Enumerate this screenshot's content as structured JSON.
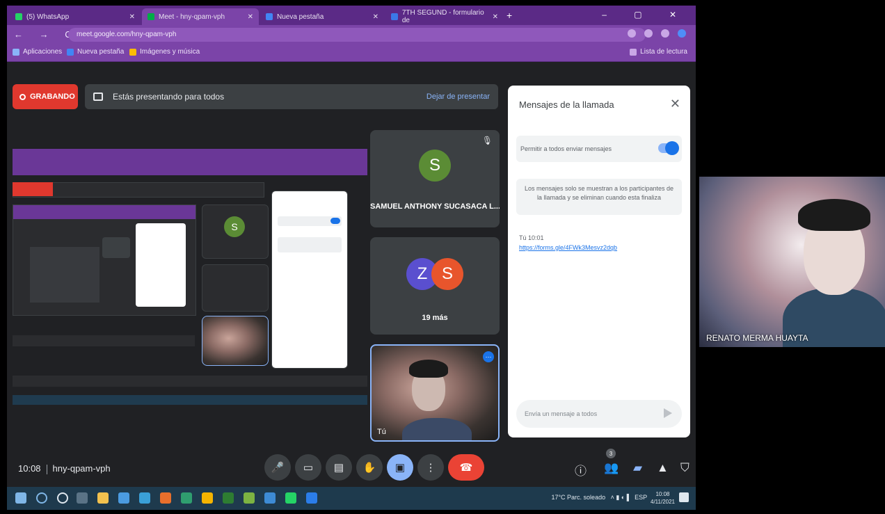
{
  "browser": {
    "tabs": [
      {
        "title": "(5) WhatsApp",
        "color": "#25d366",
        "active": false
      },
      {
        "title": "Meet - hny-qpam-vph",
        "color": "#00ac47",
        "active": true
      },
      {
        "title": "Nueva pestaña",
        "color": "#4285f4",
        "active": false
      },
      {
        "title": "7TH SEGUND - formulario de",
        "color": "#3b78e7",
        "active": false
      }
    ],
    "new_tab": "+",
    "window_controls": "–  ▢  ✕",
    "nav_icons": "← → C",
    "url": "meet.google.com/hny-qpam-vph",
    "bookmarks": [
      {
        "label": "Aplicaciones",
        "color": "#8ab4f8"
      },
      {
        "label": "Nueva pestaña",
        "color": "#4285f4"
      },
      {
        "label": "Imágenes y música",
        "color": "#fbbc04"
      }
    ],
    "reading_list": "Lista de lectura"
  },
  "meet": {
    "recording_label": "GRABANDO",
    "presenting_text": "Estás presentando para todos",
    "stop_presenting": "Dejar de presentar",
    "tiles": [
      {
        "name": "SAMUEL ANTHONY SUCASACA L...",
        "initial": "S",
        "color": "#5b8c35"
      },
      {
        "name": "19 más",
        "initials": [
          "Z",
          "S"
        ],
        "colors": [
          "#5a4fcf",
          "#e8552c"
        ]
      }
    ],
    "self_label": "Tú",
    "pinned_icon": "⋯",
    "meeting_time": "10:08",
    "meeting_code": "hny-qpam-vph",
    "participant_count": "3"
  },
  "chat": {
    "title": "Mensajes de la llamada",
    "close": "✕",
    "allow_label": "Permitir a todos enviar mensajes",
    "note": "Los mensajes solo se muestran a los participantes de la llamada y se eliminan cuando esta finaliza",
    "message_sender": "Tú 10:01",
    "message_link": "https://forms.gle/4FWk3Mesvz2dqb",
    "input_placeholder": "Envía un mensaje a todos"
  },
  "taskbar": {
    "weather": "17°C Parc. soleado",
    "lang": "ESP",
    "time": "10:08",
    "date": "4/11/2021"
  },
  "side_camera": {
    "name": "RENATO MERMA HUAYTA"
  }
}
